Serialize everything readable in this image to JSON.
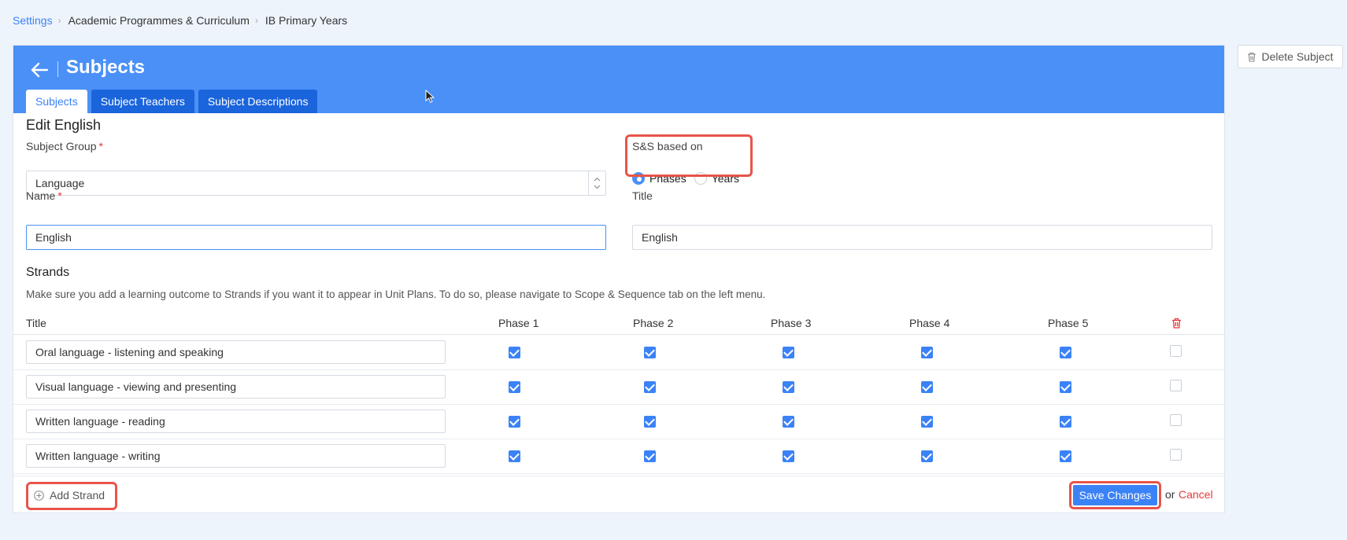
{
  "breadcrumb": {
    "items": [
      "Settings",
      "Academic Programmes & Curriculum",
      "IB Primary Years"
    ]
  },
  "delete_button": {
    "label": "Delete Subject",
    "icon": "trash-icon"
  },
  "header": {
    "title": "Subjects",
    "back_icon": "arrow-left-icon",
    "tabs": [
      {
        "label": "Subjects",
        "active": true
      },
      {
        "label": "Subject Teachers",
        "active": false
      },
      {
        "label": "Subject Descriptions",
        "active": false
      }
    ]
  },
  "form": {
    "heading": "Edit English",
    "subject_group": {
      "label": "Subject Group",
      "required_mark": "*",
      "value": "Language"
    },
    "ss_based_on": {
      "label": "S&S based on",
      "options": [
        {
          "label": "Phases",
          "selected": true
        },
        {
          "label": "Years",
          "selected": false
        }
      ]
    },
    "name": {
      "label": "Name",
      "required_mark": "*",
      "value": "English"
    },
    "title": {
      "label": "Title",
      "value": "English"
    }
  },
  "strands": {
    "heading": "Strands",
    "note": "Make sure you add a learning outcome to Strands if you want it to appear in Unit Plans. To do so, please navigate to Scope & Sequence tab on the left menu.",
    "columns": [
      "Title",
      "Phase 1",
      "Phase 2",
      "Phase 3",
      "Phase 4",
      "Phase 5"
    ],
    "rows": [
      {
        "title": "Oral language - listening and speaking",
        "phases": [
          true,
          true,
          true,
          true,
          true
        ],
        "delete": false
      },
      {
        "title": "Visual language - viewing and presenting",
        "phases": [
          true,
          true,
          true,
          true,
          true
        ],
        "delete": false
      },
      {
        "title": "Written language - reading",
        "phases": [
          true,
          true,
          true,
          true,
          true
        ],
        "delete": false
      },
      {
        "title": "Written language - writing",
        "phases": [
          true,
          true,
          true,
          true,
          true
        ],
        "delete": false
      }
    ]
  },
  "footer": {
    "add_strand": "Add Strand",
    "save": "Save Changes",
    "or": "or",
    "cancel": "Cancel"
  },
  "colors": {
    "header_bg": "#4a90f7",
    "tab_bg": "#1a64dc",
    "accent": "#3b82f6",
    "danger": "#e53935",
    "highlight": "#e8544a"
  }
}
